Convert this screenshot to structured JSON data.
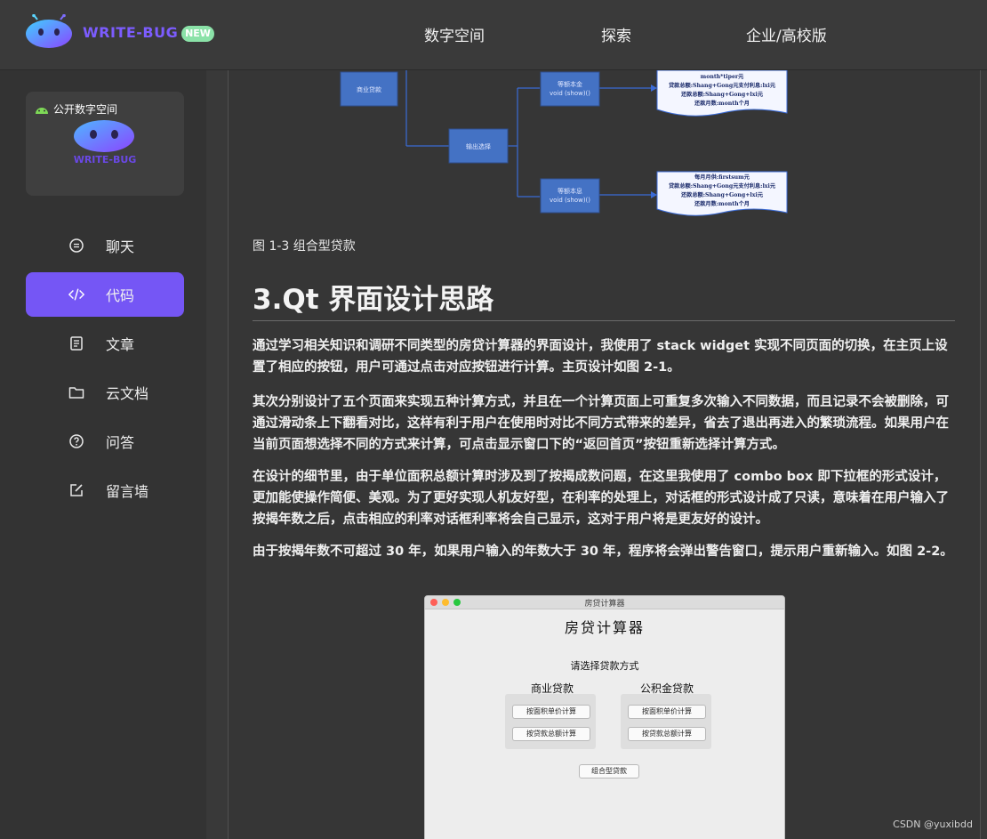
{
  "header": {
    "brand": "WRITE-BUG",
    "badge": "NEW",
    "nav": [
      "数字空间",
      "探索",
      "企业/高校版"
    ]
  },
  "sidebar": {
    "space_card": {
      "tag": "公开数字空间",
      "brand": "WRITE-BUG"
    },
    "items": [
      {
        "label": "聊天",
        "icon": "chat-icon"
      },
      {
        "label": "代码",
        "icon": "code-icon",
        "active": true
      },
      {
        "label": "文章",
        "icon": "article-icon"
      },
      {
        "label": "云文档",
        "icon": "folder-icon"
      },
      {
        "label": "问答",
        "icon": "question-icon"
      },
      {
        "label": "留言墙",
        "icon": "edit-icon"
      }
    ]
  },
  "article": {
    "diagram": {
      "box_left": "商业贷款",
      "box_mid": "输出选择",
      "box_top": "等额本金",
      "box_top_sub": "void (show)()",
      "box_bottom": "等额本息",
      "box_bottom_sub": "void (show)()",
      "doc_top_lines": [
        "month*tiper元",
        "贷款总额:Shang+Gong元支付利息:lxi元",
        "还款总额:Shang+Gong+lxi元",
        "还款月数:month个月"
      ],
      "doc_bottom_lines": [
        "每月月供:firstsum元",
        "贷款总额:Shang+Gong元支付利息:lxi元",
        "还款总额:Shang+Gong+lxi元",
        "还款月数:month个月"
      ]
    },
    "caption": "图 1-3 组合型贷款",
    "section_title": "3.Qt 界面设计思路",
    "paragraphs": [
      "通过学习相关知识和调研不同类型的房贷计算器的界面设计，我使用了 stack widget 实现不同页面的切换，在主页上设置了相应的按钮，用户可通过点击对应按钮进行计算。主页设计如图 2-1。",
      "其次分别设计了五个页面来实现五种计算方式，并且在一个计算页面上可重复多次输入不同数据，而且记录不会被删除，可通过滑动条上下翻看对比，这样有利于用户在使用时对比不同方式带来的差异，省去了退出再进入的繁琐流程。如果用户在当前页面想选择不同的方式来计算，可点击显示窗口下的“返回首页”按钮重新选择计算方式。",
      "在设计的细节里，由于单位面积总额计算时涉及到了按揭成数问题，在这里我使用了 combo box 即下拉框的形式设计，更加能使操作简便、美观。为了更好实现人机友好型，在利率的处理上，对话框的形式设计成了只读，意味着在用户输入了按揭年数之后，点击相应的利率对话框利率将会自己显示，这对于用户将是更友好的设计。",
      "由于按揭年数不可超过 30 年，如果用户输入的年数大于 30 年，程序将会弹出警告窗口，提示用户重新输入。如图 2-2。"
    ],
    "app_window": {
      "titlebar": "房贷计算器",
      "title": "房贷计算器",
      "subtitle": "请选择贷款方式",
      "group_left": "商业贷款",
      "group_right": "公积金贷款",
      "btn_area": "按面积单价计算",
      "btn_total": "按贷款总额计算",
      "btn_combo": "组合型贷款"
    }
  },
  "watermark": "CSDN @yuxibdd"
}
